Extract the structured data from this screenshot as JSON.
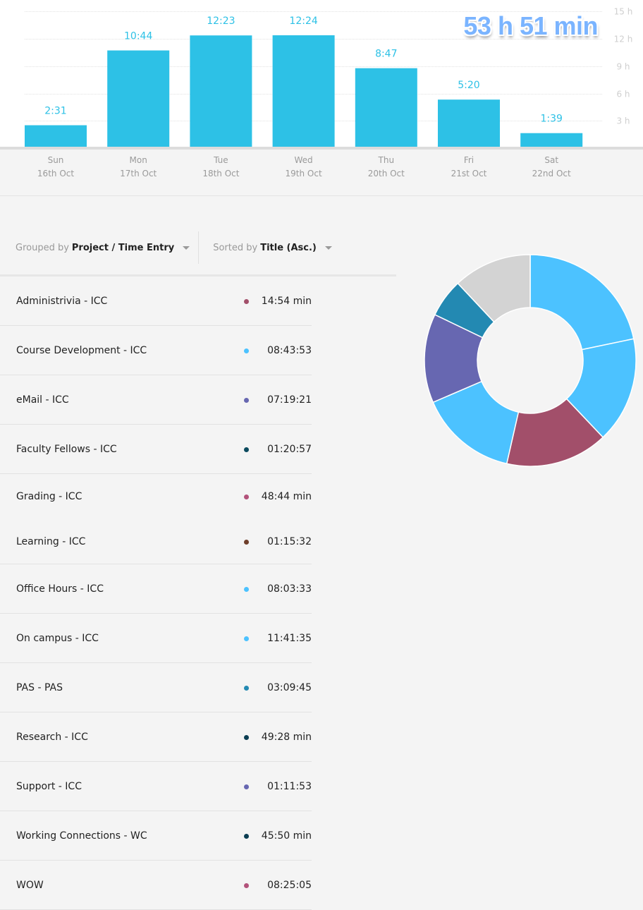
{
  "summary": {
    "total_label": "53 h 51 min"
  },
  "chart_data": [
    {
      "type": "bar",
      "title": "",
      "categories": [
        "Sun",
        "Mon",
        "Tue",
        "Wed",
        "Thu",
        "Fri",
        "Sat"
      ],
      "dates": [
        "16th Oct",
        "17th Oct",
        "18th Oct",
        "19th Oct",
        "20th Oct",
        "21st Oct",
        "22nd Oct"
      ],
      "values_hours": [
        2.517,
        10.733,
        12.383,
        12.4,
        8.783,
        5.333,
        1.65
      ],
      "data_labels": [
        "2:31",
        "10:44",
        "12:23",
        "12:24",
        "8:47",
        "5:20",
        "1:39"
      ],
      "y_ticks": [
        3,
        6,
        9,
        12,
        15
      ],
      "y_tick_labels": [
        "3 h",
        "6 h",
        "9 h",
        "12 h",
        "15 h"
      ],
      "ylim": [
        0,
        15.5
      ],
      "grid": true,
      "bar_color": "#2dc1e6",
      "label_color": "#2dc1e6",
      "xlabel": "",
      "ylabel": ""
    },
    {
      "type": "pie",
      "variant": "donut",
      "slices": [
        {
          "name": "On campus - ICC",
          "value": 11.693,
          "color": "#4cc2ff"
        },
        {
          "name": "Course Development - ICC",
          "value": 8.731,
          "color": "#4cc2ff"
        },
        {
          "name": "WOW",
          "value": 8.418,
          "color": "#a24f6a"
        },
        {
          "name": "Office Hours - ICC",
          "value": 8.059,
          "color": "#4cc2ff"
        },
        {
          "name": "eMail - ICC",
          "value": 7.323,
          "color": "#6767b1"
        },
        {
          "name": "PAS - PAS",
          "value": 3.163,
          "color": "#2389b2"
        },
        {
          "name": "Other",
          "value": 6.46,
          "color": "#d3d3d3"
        }
      ]
    }
  ],
  "controls": {
    "group_prefix": "Grouped by",
    "group_value": "Project / Time Entry",
    "sort_prefix": "Sorted by",
    "sort_value": "Title (Asc.)"
  },
  "entries": [
    {
      "title": "Administrivia - ICC",
      "duration": "14:54 min",
      "color": "#a24f6a"
    },
    {
      "title": "Course Development - ICC",
      "duration": "08:43:53",
      "color": "#4cc2ff"
    },
    {
      "title": "eMail - ICC",
      "duration": "07:19:21",
      "color": "#6767b1"
    },
    {
      "title": "Faculty Fellows - ICC",
      "duration": "01:20:57",
      "color": "#0b4a5e"
    },
    {
      "title": "Grading - ICC",
      "duration": "48:44 min",
      "color": "#b2527a"
    },
    {
      "title": "Learning - ICC",
      "duration": "01:15:32",
      "color": "#6e3e2a"
    },
    {
      "title": "Office Hours - ICC",
      "duration": "08:03:33",
      "color": "#4cc2ff"
    },
    {
      "title": "On campus - ICC",
      "duration": "11:41:35",
      "color": "#4cc2ff"
    },
    {
      "title": "PAS - PAS",
      "duration": "03:09:45",
      "color": "#2389b2"
    },
    {
      "title": "Research - ICC",
      "duration": "49:28 min",
      "color": "#0b3d52"
    },
    {
      "title": "Support - ICC",
      "duration": "01:11:53",
      "color": "#6767b1"
    },
    {
      "title": "Working Connections - WC",
      "duration": "45:50 min",
      "color": "#0b3d52"
    },
    {
      "title": "WOW",
      "duration": "08:25:05",
      "color": "#b2527a"
    }
  ]
}
